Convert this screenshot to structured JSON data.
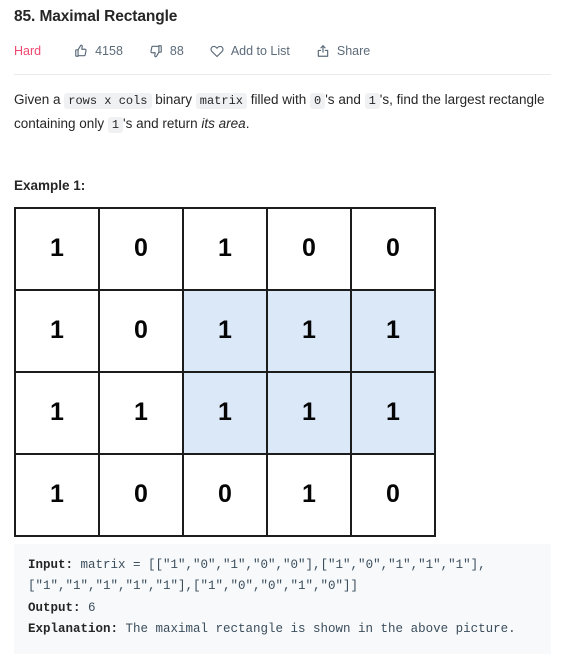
{
  "problem": {
    "title": "85. Maximal Rectangle",
    "difficulty": "Hard",
    "difficulty_color": "#ef476f",
    "likes": "4158",
    "dislikes": "88",
    "add_to_list_label": "Add to List",
    "share_label": "Share",
    "description": {
      "part1": "Given a ",
      "code1": "rows x cols",
      "part2": " binary ",
      "code2": "matrix",
      "part3": " filled with ",
      "code3": "0",
      "part4": "'s and ",
      "code4": "1",
      "part5": "'s, find the largest rectangle containing only ",
      "code5": "1",
      "part6": "'s and return ",
      "emphasis": "its area",
      "part7": "."
    },
    "example_heading": "Example 1:",
    "matrix": {
      "rows": [
        [
          {
            "v": "1",
            "hl": false
          },
          {
            "v": "0",
            "hl": false
          },
          {
            "v": "1",
            "hl": false
          },
          {
            "v": "0",
            "hl": false
          },
          {
            "v": "0",
            "hl": false
          }
        ],
        [
          {
            "v": "1",
            "hl": false
          },
          {
            "v": "0",
            "hl": false
          },
          {
            "v": "1",
            "hl": true
          },
          {
            "v": "1",
            "hl": true
          },
          {
            "v": "1",
            "hl": true
          }
        ],
        [
          {
            "v": "1",
            "hl": false
          },
          {
            "v": "1",
            "hl": false
          },
          {
            "v": "1",
            "hl": true
          },
          {
            "v": "1",
            "hl": true
          },
          {
            "v": "1",
            "hl": true
          }
        ],
        [
          {
            "v": "1",
            "hl": false
          },
          {
            "v": "0",
            "hl": false
          },
          {
            "v": "0",
            "hl": false
          },
          {
            "v": "1",
            "hl": false
          },
          {
            "v": "0",
            "hl": false
          }
        ]
      ],
      "highlight_color": "#dbe8f8"
    },
    "example": {
      "input_label": "Input:",
      "input_value": " matrix = [[\"1\",\"0\",\"1\",\"0\",\"0\"],[\"1\",\"0\",\"1\",\"1\",\"1\"],[\"1\",\"1\",\"1\",\"1\",\"1\"],[\"1\",\"0\",\"0\",\"1\",\"0\"]]",
      "output_label": "Output:",
      "output_value": " 6",
      "explanation_label": "Explanation:",
      "explanation_value": " The maximal rectangle is shown in the above picture."
    }
  },
  "icons": {
    "thumbs_up": "thumbs-up-icon",
    "thumbs_down": "thumbs-down-icon",
    "heart": "heart-icon",
    "share": "share-icon"
  }
}
